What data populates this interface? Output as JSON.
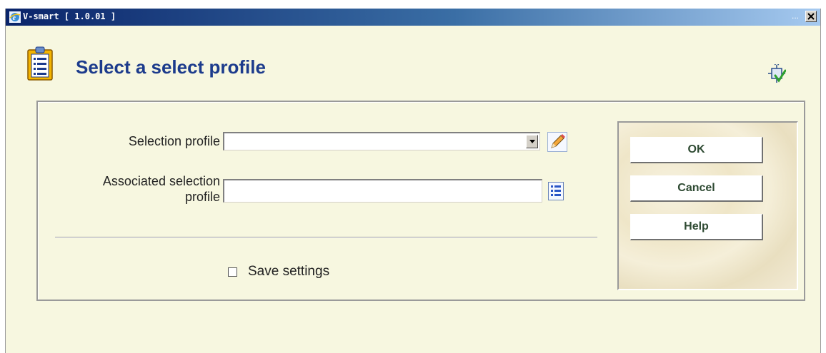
{
  "window": {
    "title": "V-smart [ 1.0.01 ]",
    "dots": "...",
    "close_label": "✕"
  },
  "header": {
    "title": "Select a select profile",
    "icon": "clipboard-list-icon",
    "tool_icon": "settings-check-icon"
  },
  "form": {
    "selection_profile_label": "Selection profile",
    "selection_profile_value": "",
    "associated_label_line1": "Associated selection",
    "associated_label_line2": "profile",
    "associated_value": "",
    "save_settings_label": "Save settings",
    "save_settings_checked": false
  },
  "buttons": {
    "ok": "OK",
    "cancel": "Cancel",
    "help": "Help"
  },
  "colors": {
    "background": "#f7f7e0",
    "title_color": "#1c3b8c",
    "button_text": "#2e4a32"
  }
}
